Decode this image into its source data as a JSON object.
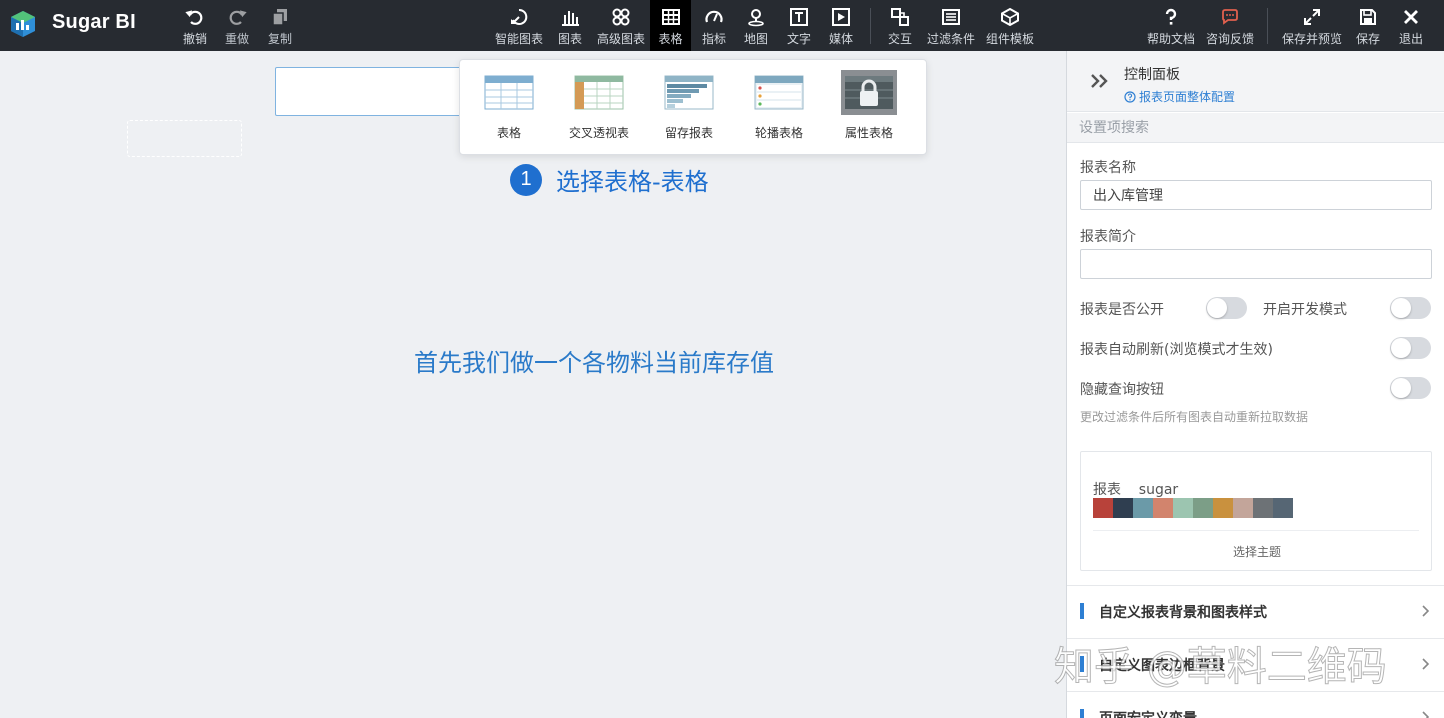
{
  "app": {
    "name": "Sugar BI"
  },
  "toolbar": {
    "undo": "撤销",
    "redo": "重做",
    "copy": "复制",
    "smart_chart": "智能图表",
    "chart": "图表",
    "advanced_chart": "高级图表",
    "table": "表格",
    "indicator": "指标",
    "map": "地图",
    "text": "文字",
    "media": "媒体",
    "interaction": "交互",
    "filter": "过滤条件",
    "component_template": "组件模板",
    "help_doc": "帮助文档",
    "feedback": "咨询反馈",
    "save_preview": "保存并预览",
    "save": "保存",
    "exit": "退出"
  },
  "table_menu": {
    "items": [
      "表格",
      "交叉透视表",
      "留存报表",
      "轮播表格",
      "属性表格"
    ]
  },
  "step": {
    "number": "1",
    "text": "选择表格-表格"
  },
  "canvas": {
    "caption": "首先我们做一个各物料当前库存值"
  },
  "panel": {
    "title": "控制面板",
    "config_link": "报表页面整体配置",
    "search_placeholder": "设置项搜索",
    "report_name_label": "报表名称",
    "report_name_value": "出入库管理",
    "report_desc_label": "报表简介",
    "report_desc_value": "",
    "public_label": "报表是否公开",
    "dev_mode_label": "开启开发模式",
    "auto_refresh_label": "报表自动刷新(浏览模式才生效)",
    "hide_query_label": "隐藏查询按钮",
    "hide_query_hint": "更改过滤条件后所有图表自动重新拉取数据",
    "theme": {
      "name": "报表    sugar",
      "colors": [
        "#b8423a",
        "#2f3e50",
        "#6b9aa8",
        "#d2846d",
        "#9cc5b0",
        "#7c9e87",
        "#c9913e",
        "#c3a59a",
        "#6d7276",
        "#566674"
      ],
      "select_button": "选择主题"
    },
    "sections": [
      "自定义报表背景和图表样式",
      "自定义图表边框背景",
      "页面宏定义变量"
    ],
    "public_on": false,
    "dev_mode_on": false,
    "auto_refresh_on": false,
    "hide_query_on": false
  },
  "watermark": "知乎 @草料二维码"
}
